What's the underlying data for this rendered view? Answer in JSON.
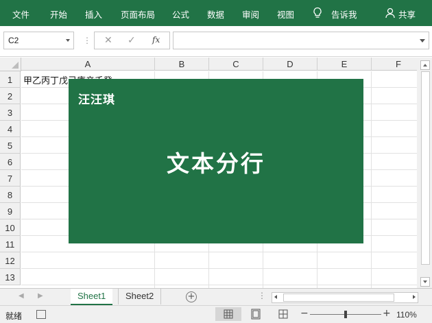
{
  "ribbon": {
    "tabs": [
      "文件",
      "开始",
      "插入",
      "页面布局",
      "公式",
      "数据",
      "审阅",
      "视图"
    ],
    "tell_me": "告诉我",
    "share": "共享"
  },
  "formula_bar": {
    "name_box": "C2",
    "fx": "fx",
    "formula": ""
  },
  "grid": {
    "columns": [
      "A",
      "B",
      "C",
      "D",
      "E",
      "F"
    ],
    "rows": [
      "1",
      "2",
      "3",
      "4",
      "5",
      "6",
      "7",
      "8",
      "9",
      "10",
      "11",
      "12",
      "13"
    ],
    "a1": "甲乙丙丁戊己庚辛壬癸"
  },
  "overlay": {
    "brand": "汪汪琪",
    "title": "文本分行",
    "color": "#217346"
  },
  "sheets": {
    "tabs": [
      "Sheet1",
      "Sheet2"
    ],
    "active": "Sheet1"
  },
  "status": {
    "ready": "就绪",
    "zoom": "110%",
    "zoom_minus": "−",
    "zoom_plus": "+"
  }
}
